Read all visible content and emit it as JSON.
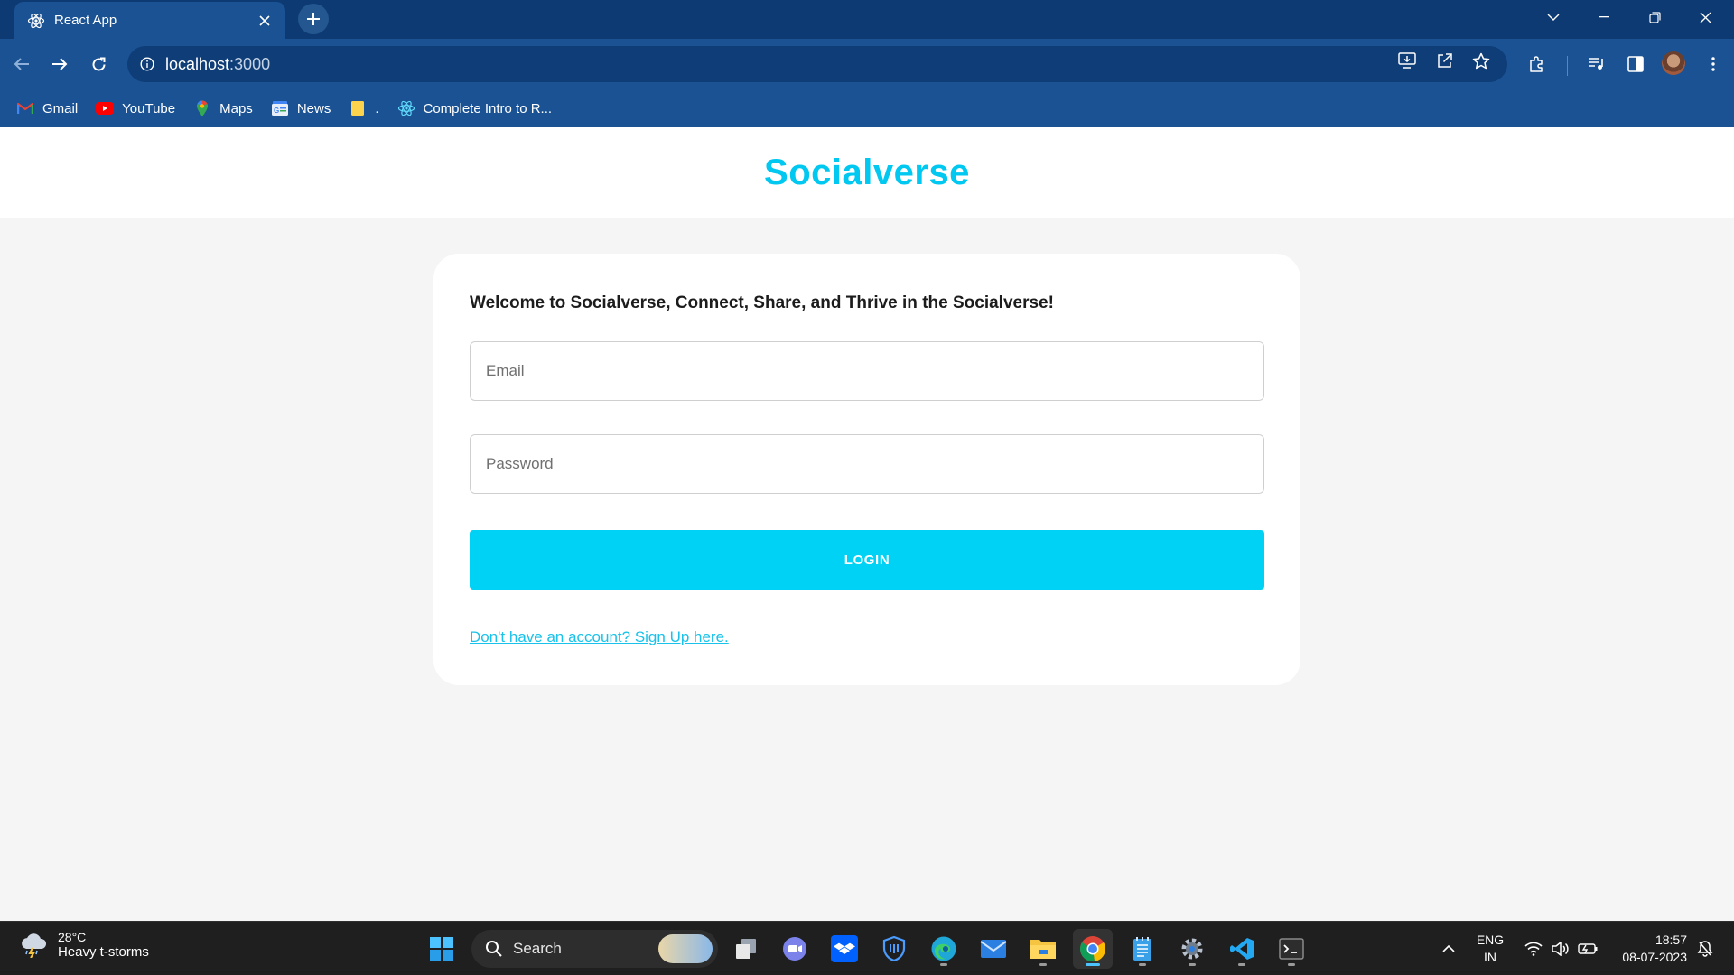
{
  "browser": {
    "tab_title": "React App",
    "url_host": "localhost",
    "url_port": ":3000",
    "bookmarks": [
      {
        "label": "Gmail",
        "icon": "gmail-icon"
      },
      {
        "label": "YouTube",
        "icon": "youtube-icon"
      },
      {
        "label": "Maps",
        "icon": "maps-icon"
      },
      {
        "label": "News",
        "icon": "news-icon"
      },
      {
        "label": ".",
        "icon": "folder-note-icon"
      },
      {
        "label": "Complete Intro to R...",
        "icon": "react-icon"
      }
    ]
  },
  "app": {
    "brand": "Socialverse",
    "welcome": "Welcome to Socialverse, Connect, Share, and Thrive in the Socialverse!",
    "email_placeholder": "Email",
    "password_placeholder": "Password",
    "login_label": "LOGIN",
    "signup_link": "Don't have an account? Sign Up here.",
    "colors": {
      "accent": "#00d2f5",
      "brand": "#00c8f0",
      "link": "#19c2ea"
    }
  },
  "taskbar": {
    "weather_temp": "28°C",
    "weather_desc": "Heavy t-storms",
    "search_label": "Search",
    "lang_line1": "ENG",
    "lang_line2": "IN",
    "time": "18:57",
    "date": "08-07-2023"
  }
}
